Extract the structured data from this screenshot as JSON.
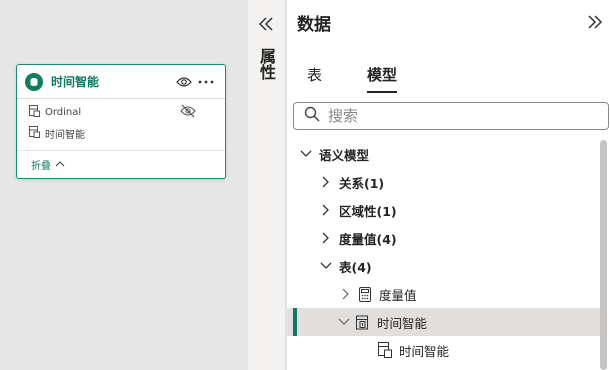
{
  "card": {
    "title": "时间智能",
    "fields": [
      "Ordinal",
      "时间智能"
    ],
    "collapse_label": "折叠"
  },
  "properties": {
    "label": "属性"
  },
  "data_pane": {
    "title": "数据",
    "tabs": [
      "表",
      "模型"
    ],
    "active_tab": "模型",
    "search_placeholder": "搜索"
  },
  "tree": {
    "root": "语义模型",
    "relationships": "关系(1)",
    "perspectives": "区域性(1)",
    "measures": "度量值(4)",
    "tables": "表(4)",
    "tbl_measures": "度量值",
    "tbl_time": "时间智能",
    "tbl_time_col": "时间智能"
  },
  "colors": {
    "accent": "#117865",
    "selection": "#e1dfdd"
  }
}
